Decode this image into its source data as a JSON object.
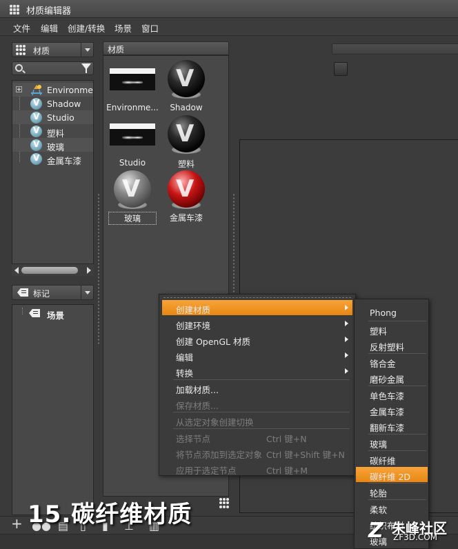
{
  "window": {
    "title": "材质编辑器"
  },
  "menubar": [
    "文件",
    "编辑",
    "创建/转换",
    "场景",
    "窗口"
  ],
  "library": {
    "dropdown_label": "材质",
    "items": [
      {
        "label": "Environment",
        "icon": "environment-icon"
      },
      {
        "label": "Shadow",
        "icon": "material-v-icon"
      },
      {
        "label": "Studio",
        "icon": "material-v-icon"
      },
      {
        "label": "塑料",
        "icon": "material-v-icon"
      },
      {
        "label": "玻璃",
        "icon": "material-v-icon"
      },
      {
        "label": "金属车漆",
        "icon": "material-v-icon"
      }
    ]
  },
  "tags": {
    "dropdown_label": "标记",
    "items": [
      {
        "label": "场景"
      }
    ]
  },
  "thumbnails": {
    "header": "材质",
    "items": [
      {
        "label": "Environme...",
        "kind": "environment"
      },
      {
        "label": "Shadow",
        "kind": "black"
      },
      {
        "label": "Studio",
        "kind": "environment"
      },
      {
        "label": "塑料",
        "kind": "black"
      },
      {
        "label": "玻璃",
        "kind": "grey"
      },
      {
        "label": "金属车漆",
        "kind": "red"
      }
    ]
  },
  "context_menu": {
    "items": [
      {
        "label": "创建材质",
        "submenu": true,
        "active": true
      },
      {
        "label": "创建环境",
        "submenu": true
      },
      {
        "label": "创建 OpenGL 材质",
        "submenu": true
      },
      {
        "label": "编辑",
        "submenu": true
      },
      {
        "label": "转换",
        "submenu": true
      },
      {
        "label": "加载材质..."
      },
      {
        "label": "保存材质...",
        "disabled": true
      },
      {
        "label": "从选定对象创建切换",
        "disabled": true
      },
      {
        "label": "选择节点",
        "shortcut": "Ctrl 键+N",
        "disabled": true
      },
      {
        "label": "将节点添加到选定对象",
        "shortcut": "Ctrl 键+Shift 键+N",
        "disabled": true
      },
      {
        "label": "应用于选定节点",
        "shortcut": "Ctrl 键+M",
        "disabled": true
      }
    ]
  },
  "submenu": {
    "items": [
      "Phong",
      "塑料",
      "反射塑料",
      "铬合金",
      "磨砂金属",
      "单色车漆",
      "金属车漆",
      "翻新车漆",
      "玻璃",
      "碳纤维",
      "碳纤维 2D",
      "轮胎",
      "柔软",
      "纺织布料",
      "玻璃"
    ],
    "active": "碳纤维 2D"
  },
  "caption": "15.碳纤维材质",
  "watermark": {
    "text": "朱峰社区",
    "url": "ZF3D.COM"
  },
  "colors": {
    "accent": "#f29a2e",
    "panel": "#484848",
    "background": "#3a3a3a"
  }
}
